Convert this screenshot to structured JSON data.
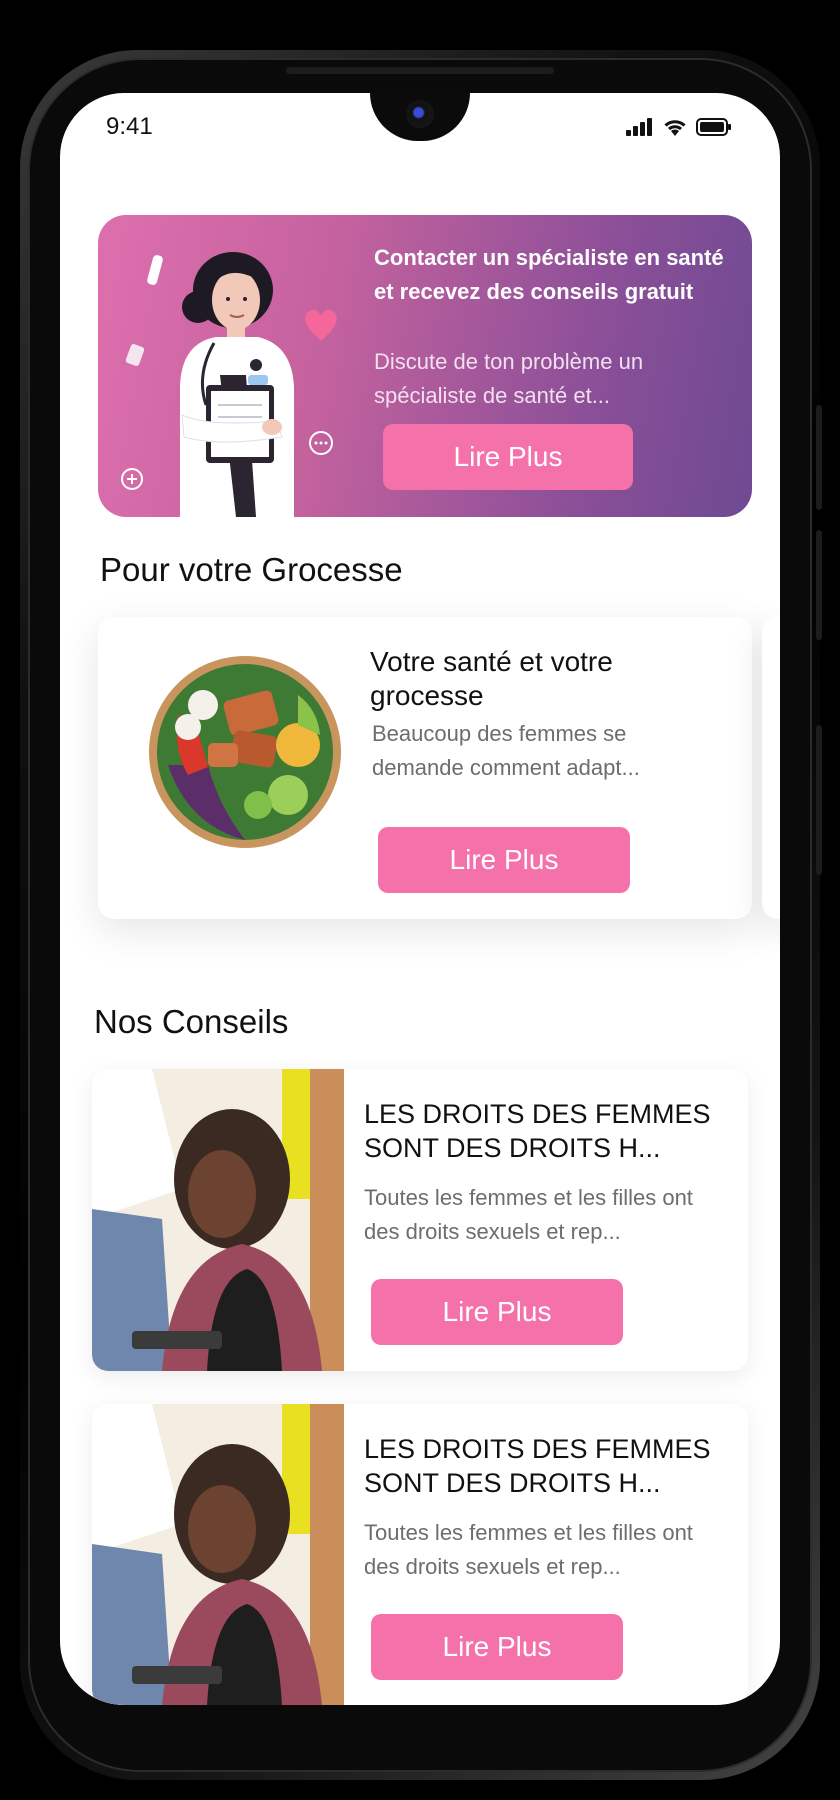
{
  "status_bar": {
    "time": "9:41"
  },
  "hero": {
    "title": "Contacter un spécialiste en santé et recevez des conseils gratuit",
    "subtitle": "Discute de ton problème un spécialiste de santé et...",
    "button": "Lire Plus"
  },
  "pregnancy": {
    "section_title": "Pour votre Grocesse",
    "card": {
      "title": "Votre santé et votre grocesse",
      "desc_line1": "Beaucoup des femmes se",
      "desc_line2": "demande comment adapt...",
      "button": "Lire Plus"
    }
  },
  "advice": {
    "section_title": "Nos Conseils",
    "items": [
      {
        "title": "LES DROITS DES FEMMES SONT DES DROITS H...",
        "desc": "Toutes les femmes et les filles ont des droits sexuels et rep...",
        "button": "Lire Plus"
      },
      {
        "title": "LES DROITS DES FEMMES SONT DES DROITS H...",
        "desc": "Toutes les femmes et les filles ont des droits sexuels et rep...",
        "button": "Lire Plus"
      }
    ]
  },
  "colors": {
    "accent": "#f472a9",
    "banner_start": "#de6fae",
    "banner_end": "#6e4a92"
  },
  "icons": [
    "signal-icon",
    "wifi-icon",
    "battery-icon",
    "heart-icon",
    "chat-bubble-icon",
    "plus-circle-icon"
  ]
}
